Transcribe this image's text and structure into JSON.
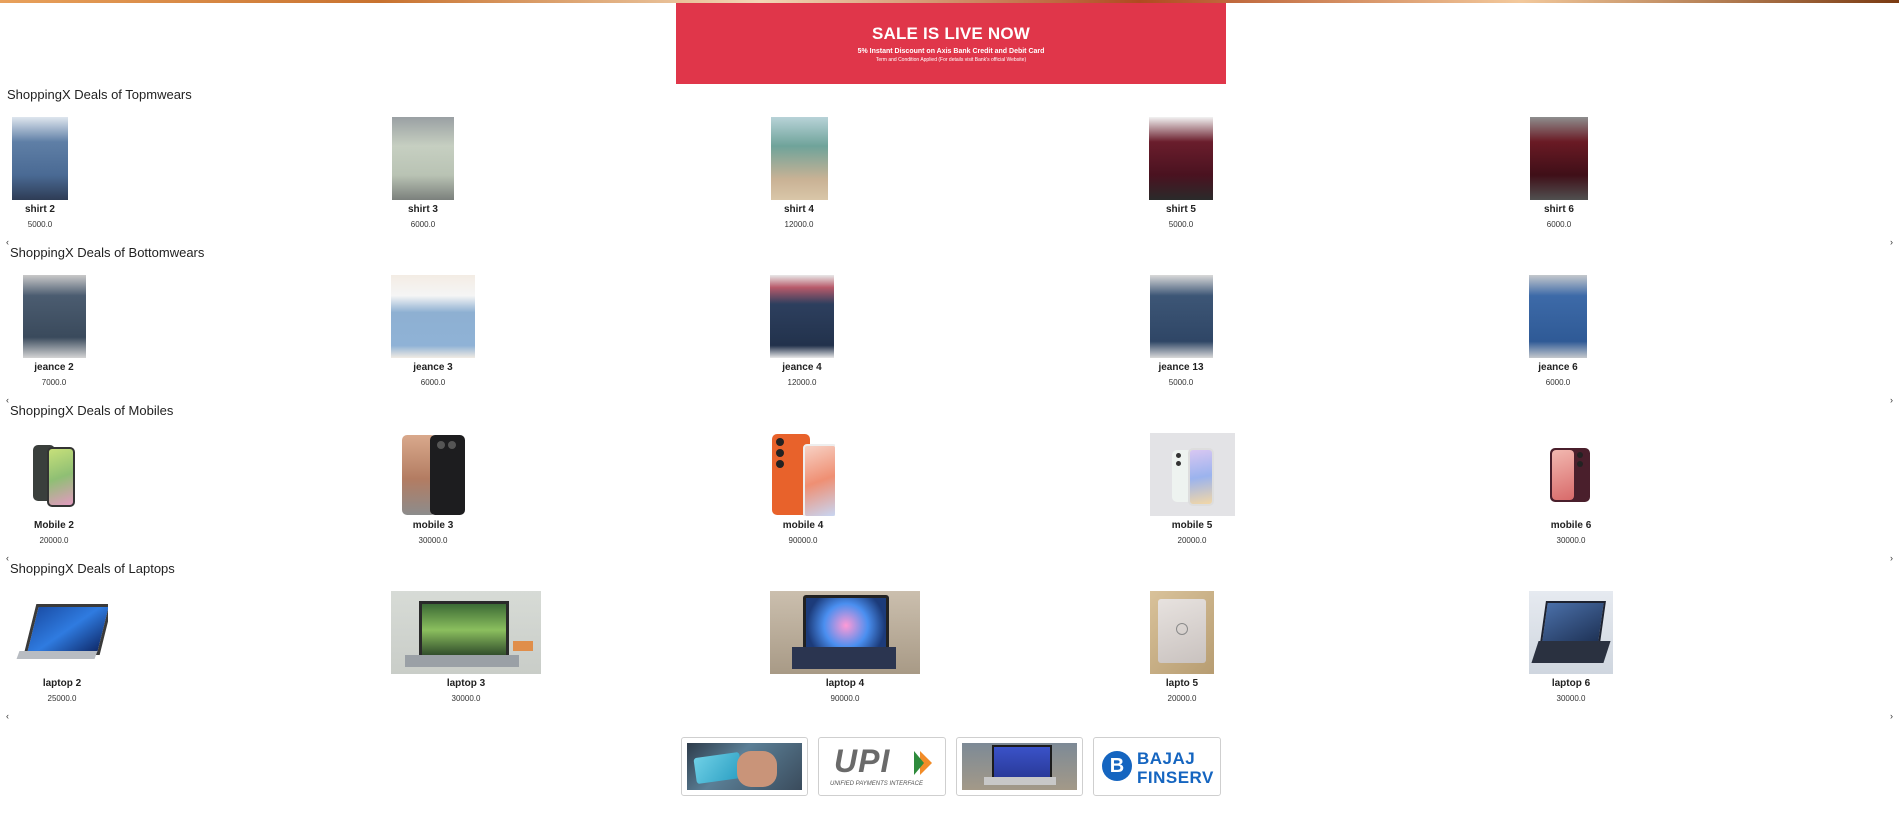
{
  "banner": {
    "title": "SALE IS LIVE NOW",
    "line1": "5% Instant Discount on Axis Bank Credit and Debit Card",
    "line2": "Term and Condition Applied (For details visit Bank's official Website)"
  },
  "sections": [
    {
      "title": "ShoppingX Deals of Topmwears",
      "products": [
        {
          "name": "shirt 2",
          "price": "5000.0"
        },
        {
          "name": "shirt 3",
          "price": "6000.0"
        },
        {
          "name": "shirt 4",
          "price": "12000.0"
        },
        {
          "name": "shirt 5",
          "price": "5000.0"
        },
        {
          "name": "shirt 6",
          "price": "6000.0"
        }
      ]
    },
    {
      "title": "ShoppingX Deals of Bottomwears",
      "products": [
        {
          "name": "jeance 2",
          "price": "7000.0"
        },
        {
          "name": "jeance 3",
          "price": "6000.0"
        },
        {
          "name": "jeance 4",
          "price": "12000.0"
        },
        {
          "name": "jeance 13",
          "price": "5000.0"
        },
        {
          "name": "jeance 6",
          "price": "6000.0"
        }
      ]
    },
    {
      "title": "ShoppingX Deals of Mobiles",
      "products": [
        {
          "name": "Mobile 2",
          "price": "20000.0"
        },
        {
          "name": "mobile 3",
          "price": "30000.0"
        },
        {
          "name": "mobile 4",
          "price": "90000.0"
        },
        {
          "name": "mobile 5",
          "price": "20000.0"
        },
        {
          "name": "mobile 6",
          "price": "30000.0"
        }
      ]
    },
    {
      "title": "ShoppingX Deals of Laptops",
      "products": [
        {
          "name": "laptop 2",
          "price": "25000.0"
        },
        {
          "name": "laptop 3",
          "price": "30000.0"
        },
        {
          "name": "laptop 4",
          "price": "90000.0"
        },
        {
          "name": "lapto 5",
          "price": "20000.0"
        },
        {
          "name": "laptop 6",
          "price": "30000.0"
        }
      ]
    }
  ],
  "carousel": {
    "prev": "‹",
    "next": "›"
  },
  "payments": {
    "upi_text": "UPI",
    "upi_sub": "UNIFIED PAYMENTS INTERFACE",
    "bajaj_line1": "BAJAJ",
    "bajaj_line2": "FINSERV",
    "bajaj_mark": "B"
  },
  "colors": {
    "banner": "#e0364a",
    "bajaj_blue": "#1565c0"
  }
}
